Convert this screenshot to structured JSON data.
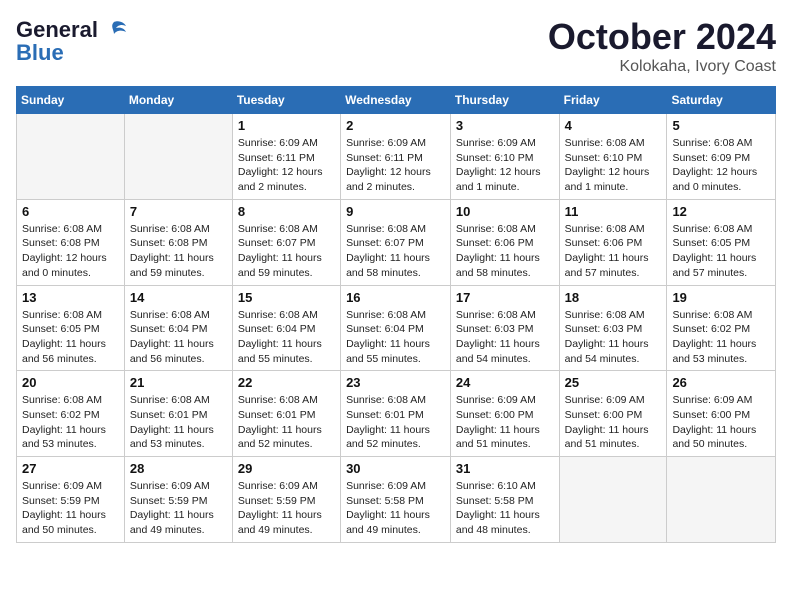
{
  "logo": {
    "line1": "General",
    "line2": "Blue"
  },
  "title": "October 2024",
  "location": "Kolokaha, Ivory Coast",
  "days_of_week": [
    "Sunday",
    "Monday",
    "Tuesday",
    "Wednesday",
    "Thursday",
    "Friday",
    "Saturday"
  ],
  "weeks": [
    [
      {
        "day": "",
        "info": ""
      },
      {
        "day": "",
        "info": ""
      },
      {
        "day": "1",
        "info": "Sunrise: 6:09 AM\nSunset: 6:11 PM\nDaylight: 12 hours and 2 minutes."
      },
      {
        "day": "2",
        "info": "Sunrise: 6:09 AM\nSunset: 6:11 PM\nDaylight: 12 hours and 2 minutes."
      },
      {
        "day": "3",
        "info": "Sunrise: 6:09 AM\nSunset: 6:10 PM\nDaylight: 12 hours and 1 minute."
      },
      {
        "day": "4",
        "info": "Sunrise: 6:08 AM\nSunset: 6:10 PM\nDaylight: 12 hours and 1 minute."
      },
      {
        "day": "5",
        "info": "Sunrise: 6:08 AM\nSunset: 6:09 PM\nDaylight: 12 hours and 0 minutes."
      }
    ],
    [
      {
        "day": "6",
        "info": "Sunrise: 6:08 AM\nSunset: 6:08 PM\nDaylight: 12 hours and 0 minutes."
      },
      {
        "day": "7",
        "info": "Sunrise: 6:08 AM\nSunset: 6:08 PM\nDaylight: 11 hours and 59 minutes."
      },
      {
        "day": "8",
        "info": "Sunrise: 6:08 AM\nSunset: 6:07 PM\nDaylight: 11 hours and 59 minutes."
      },
      {
        "day": "9",
        "info": "Sunrise: 6:08 AM\nSunset: 6:07 PM\nDaylight: 11 hours and 58 minutes."
      },
      {
        "day": "10",
        "info": "Sunrise: 6:08 AM\nSunset: 6:06 PM\nDaylight: 11 hours and 58 minutes."
      },
      {
        "day": "11",
        "info": "Sunrise: 6:08 AM\nSunset: 6:06 PM\nDaylight: 11 hours and 57 minutes."
      },
      {
        "day": "12",
        "info": "Sunrise: 6:08 AM\nSunset: 6:05 PM\nDaylight: 11 hours and 57 minutes."
      }
    ],
    [
      {
        "day": "13",
        "info": "Sunrise: 6:08 AM\nSunset: 6:05 PM\nDaylight: 11 hours and 56 minutes."
      },
      {
        "day": "14",
        "info": "Sunrise: 6:08 AM\nSunset: 6:04 PM\nDaylight: 11 hours and 56 minutes."
      },
      {
        "day": "15",
        "info": "Sunrise: 6:08 AM\nSunset: 6:04 PM\nDaylight: 11 hours and 55 minutes."
      },
      {
        "day": "16",
        "info": "Sunrise: 6:08 AM\nSunset: 6:04 PM\nDaylight: 11 hours and 55 minutes."
      },
      {
        "day": "17",
        "info": "Sunrise: 6:08 AM\nSunset: 6:03 PM\nDaylight: 11 hours and 54 minutes."
      },
      {
        "day": "18",
        "info": "Sunrise: 6:08 AM\nSunset: 6:03 PM\nDaylight: 11 hours and 54 minutes."
      },
      {
        "day": "19",
        "info": "Sunrise: 6:08 AM\nSunset: 6:02 PM\nDaylight: 11 hours and 53 minutes."
      }
    ],
    [
      {
        "day": "20",
        "info": "Sunrise: 6:08 AM\nSunset: 6:02 PM\nDaylight: 11 hours and 53 minutes."
      },
      {
        "day": "21",
        "info": "Sunrise: 6:08 AM\nSunset: 6:01 PM\nDaylight: 11 hours and 53 minutes."
      },
      {
        "day": "22",
        "info": "Sunrise: 6:08 AM\nSunset: 6:01 PM\nDaylight: 11 hours and 52 minutes."
      },
      {
        "day": "23",
        "info": "Sunrise: 6:08 AM\nSunset: 6:01 PM\nDaylight: 11 hours and 52 minutes."
      },
      {
        "day": "24",
        "info": "Sunrise: 6:09 AM\nSunset: 6:00 PM\nDaylight: 11 hours and 51 minutes."
      },
      {
        "day": "25",
        "info": "Sunrise: 6:09 AM\nSunset: 6:00 PM\nDaylight: 11 hours and 51 minutes."
      },
      {
        "day": "26",
        "info": "Sunrise: 6:09 AM\nSunset: 6:00 PM\nDaylight: 11 hours and 50 minutes."
      }
    ],
    [
      {
        "day": "27",
        "info": "Sunrise: 6:09 AM\nSunset: 5:59 PM\nDaylight: 11 hours and 50 minutes."
      },
      {
        "day": "28",
        "info": "Sunrise: 6:09 AM\nSunset: 5:59 PM\nDaylight: 11 hours and 49 minutes."
      },
      {
        "day": "29",
        "info": "Sunrise: 6:09 AM\nSunset: 5:59 PM\nDaylight: 11 hours and 49 minutes."
      },
      {
        "day": "30",
        "info": "Sunrise: 6:09 AM\nSunset: 5:58 PM\nDaylight: 11 hours and 49 minutes."
      },
      {
        "day": "31",
        "info": "Sunrise: 6:10 AM\nSunset: 5:58 PM\nDaylight: 11 hours and 48 minutes."
      },
      {
        "day": "",
        "info": ""
      },
      {
        "day": "",
        "info": ""
      }
    ]
  ]
}
